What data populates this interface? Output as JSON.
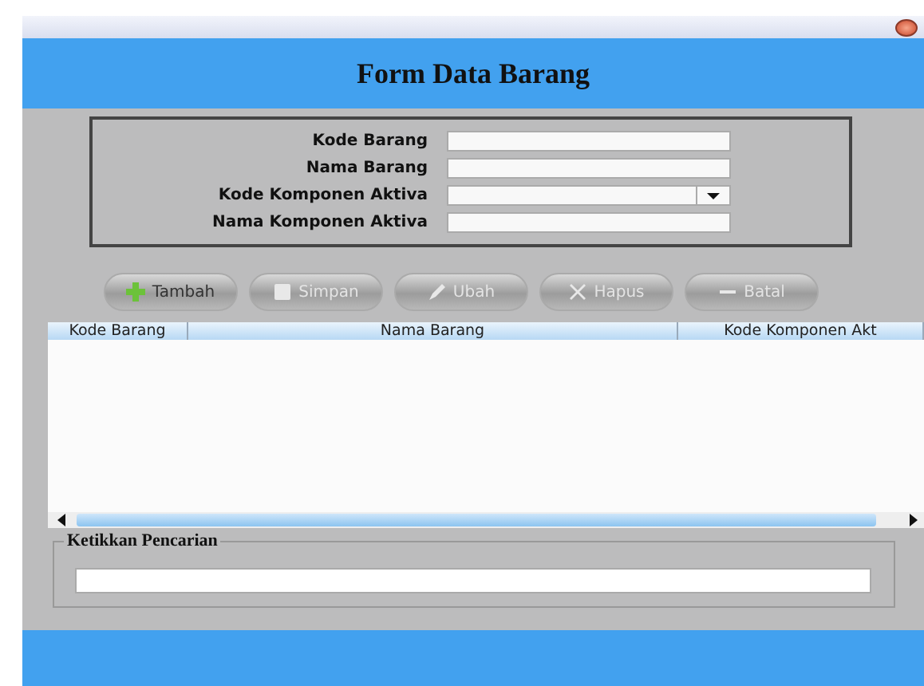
{
  "window": {
    "title": "Form Data Barang"
  },
  "fields": [
    {
      "label": "Kode Barang",
      "kind": "text"
    },
    {
      "label": "Nama Barang",
      "kind": "text"
    },
    {
      "label": "Kode Komponen Aktiva",
      "kind": "combo"
    },
    {
      "label": "Nama Komponen Aktiva",
      "kind": "text"
    }
  ],
  "buttons": [
    {
      "label": "Tambah",
      "kind": "plus",
      "disabled": false
    },
    {
      "label": "Simpan",
      "kind": "disk",
      "disabled": true
    },
    {
      "label": "Ubah",
      "kind": "pencil",
      "disabled": true
    },
    {
      "label": "Hapus",
      "kind": "cross",
      "disabled": true
    },
    {
      "label": "Batal",
      "kind": "minus",
      "disabled": true
    }
  ],
  "table": {
    "columns": [
      "Kode Barang",
      "Nama Barang",
      "Kode Komponen Akt"
    ]
  },
  "search": {
    "title": "Ketikkan Pencarian"
  }
}
